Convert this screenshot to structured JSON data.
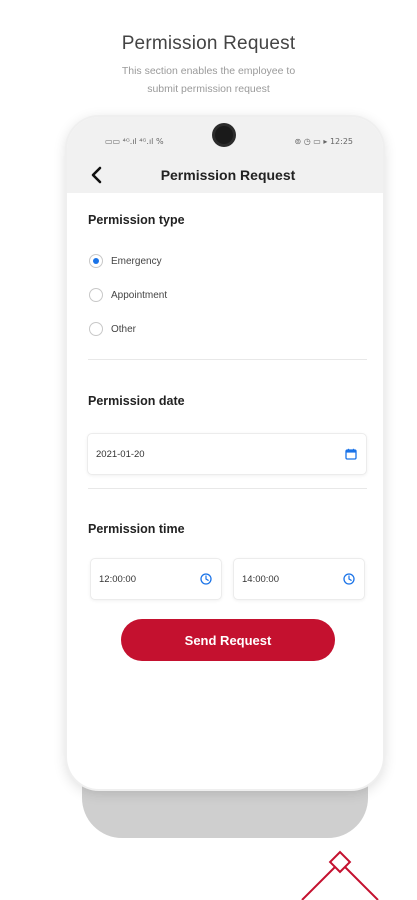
{
  "promo": {
    "title": "Permission Request",
    "subtitle_line1": "This section enables the employee to",
    "subtitle_line2": "submit permission request"
  },
  "status_bar": {
    "left": "▭▭ ⁴ᴳ.ıl ⁴ᴳ.ıl %",
    "right": "⊚ ◷ ▭ ▸ 12:25",
    "time": "12:25"
  },
  "app_bar": {
    "title": "Permission Request",
    "back_icon": "chevron-left-icon"
  },
  "form": {
    "type_label": "Permission type",
    "options": [
      {
        "label": "Emergency",
        "selected": true
      },
      {
        "label": "Appointment",
        "selected": false
      },
      {
        "label": "Other",
        "selected": false
      }
    ],
    "date_label": "Permission date",
    "date_value": "2021-01-20",
    "date_icon": "calendar-icon",
    "time_label": "Permission time",
    "time_from": "12:00:00",
    "time_to": "14:00:00",
    "time_icon": "clock-icon",
    "submit_label": "Send Request"
  },
  "colors": {
    "accent": "#c4112f",
    "radio_selected": "#1a73e8",
    "icon_blue": "#1a73e8"
  }
}
